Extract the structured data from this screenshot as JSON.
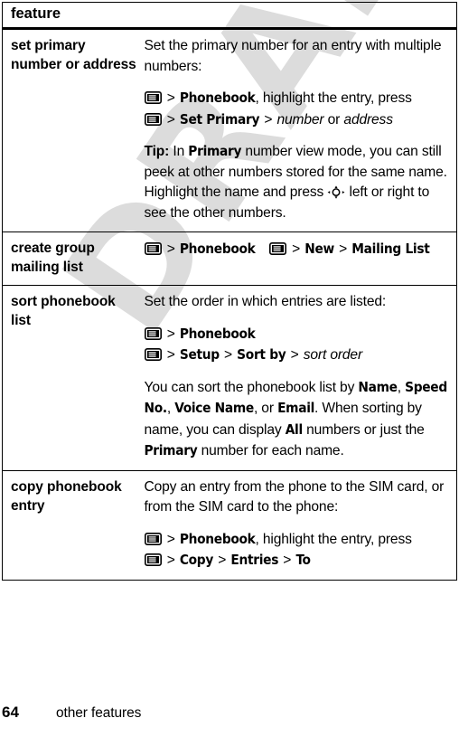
{
  "document": {
    "watermark": "DRAFT",
    "page_number": "64",
    "section_title": "other features"
  },
  "table": {
    "header": "feature",
    "rows": [
      {
        "term": "set primary number or address",
        "blocks": [
          {
            "type": "text",
            "text": "Set the primary number for an entry with multiple numbers:"
          },
          {
            "type": "steps",
            "lines": [
              "MENU > Phonebook, highlight the entry, press",
              "MENU > Set Primary > number or address"
            ]
          },
          {
            "type": "tip",
            "label": "Tip:",
            "text": "In Primary number view mode, you can still peek at other numbers stored for the same name. Highlight the name and press NAV left or right to see the other numbers."
          }
        ]
      },
      {
        "term": "create group mailing list",
        "blocks": [
          {
            "type": "steps",
            "lines": [
              "MENU > Phonebook   MENU > New > Mailing List"
            ]
          }
        ]
      },
      {
        "term": "sort phonebook list",
        "blocks": [
          {
            "type": "text",
            "text": "Set the order in which entries are listed:"
          },
          {
            "type": "steps",
            "lines": [
              "MENU > Phonebook",
              "MENU > Setup > Sort by > sort order"
            ]
          },
          {
            "type": "text",
            "text": "You can sort the phonebook list by Name, Speed No., Voice Name, or Email. When sorting by name, you can display All numbers or just the Primary number for each name."
          }
        ]
      },
      {
        "term": "copy phonebook entry",
        "blocks": [
          {
            "type": "text",
            "text": "Copy an entry from the phone to the SIM card, or from the SIM card to the phone:"
          },
          {
            "type": "steps",
            "lines": [
              "MENU > Phonebook, highlight the entry, press",
              "MENU > Copy > Entries > To"
            ]
          }
        ]
      }
    ]
  },
  "icons": {
    "menu_key": "menu-key-icon",
    "nav_key": "navigation-key-icon"
  },
  "colors": {
    "watermark": "#dcdcdc",
    "rule": "#000000",
    "text": "#000000"
  },
  "labels": {
    "row1_term": "set primary number or address",
    "row1_p1": "Set the primary number for an entry with multiple numbers:",
    "row1_step1_a": "Phonebook",
    "row1_step1_b": ", highlight the entry, press",
    "row1_step2_a": "Set Primary",
    "row1_step2_b": "number",
    "row1_step2_c": "or",
    "row1_step2_d": "address",
    "row1_tip_label": "Tip:",
    "row1_tip_a": "In",
    "row1_tip_b": "Primary",
    "row1_tip_c": "number view mode, you can still peek at other numbers stored for the same name. Highlight the name and press",
    "row1_tip_d": "left or right to see the other numbers.",
    "row2_term": "create group mailing list",
    "row2_step_a": "Phonebook",
    "row2_step_b": "New",
    "row2_step_c": "Mailing List",
    "row3_term": "sort phonebook list",
    "row3_p1": "Set the order in which entries are listed:",
    "row3_step1_a": "Phonebook",
    "row3_step2_a": "Setup",
    "row3_step2_b": "Sort by",
    "row3_step2_c": "sort order",
    "row3_p2_a": "You can sort the phonebook list by",
    "row3_p2_name": "Name",
    "row3_p2_comma1": ",",
    "row3_p2_speed": "Speed No.",
    "row3_p2_comma2": ",",
    "row3_p2_voice": "Voice Name",
    "row3_p2_or": ", or",
    "row3_p2_email": "Email",
    "row3_p2_b": ". When sorting by name, you can display",
    "row3_p2_all": "All",
    "row3_p2_c": "numbers or just the",
    "row3_p2_primary": "Primary",
    "row3_p2_d": "number for each name.",
    "row4_term": "copy phonebook entry",
    "row4_p1": "Copy an entry from the phone to the SIM card, or from the SIM card to the phone:",
    "row4_step1_a": "Phonebook",
    "row4_step1_b": ", highlight the entry, press",
    "row4_step2_a": "Copy",
    "row4_step2_b": "Entries",
    "row4_step2_c": "To",
    "gt": ">"
  }
}
